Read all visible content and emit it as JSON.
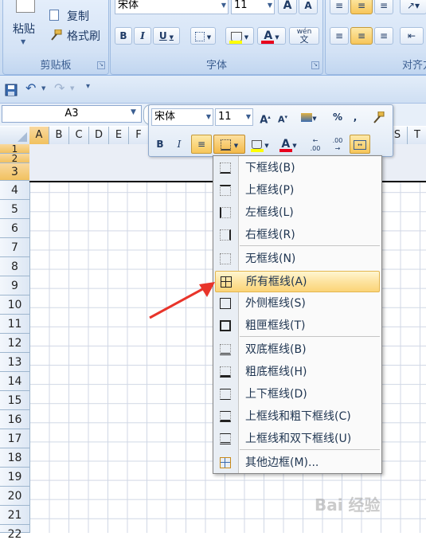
{
  "ribbon": {
    "paste_label": "粘贴",
    "copy_label": "复制",
    "format_painter_label": "格式刷",
    "clipboard_group": "剪贴板",
    "font_group": "字体",
    "align_group": "对齐方",
    "font_name": "宋体",
    "font_size": "11",
    "grow_font": "A",
    "shrink_font": "A",
    "bold": "B",
    "italic": "I",
    "underline": "U",
    "font_color_letter": "A",
    "phonetic": "wén",
    "phonetic_char": "文"
  },
  "name_box": "A3",
  "columns": [
    "A",
    "B",
    "C",
    "D",
    "E",
    "F",
    "S",
    "T"
  ],
  "rows": [
    "1",
    "2",
    "3",
    "4",
    "5",
    "6",
    "7",
    "8",
    "9",
    "10",
    "11",
    "12",
    "13",
    "14",
    "15",
    "16",
    "17",
    "18",
    "19",
    "20",
    "21",
    "22"
  ],
  "mini_toolbar": {
    "font_name": "宋体",
    "font_size": "11",
    "percent": "%",
    "comma": ",",
    "bold": "B",
    "italic": "I",
    "font_color_letter": "A",
    "inc_decimal": ".00",
    "dec_decimal": ".00"
  },
  "border_menu": {
    "items": [
      {
        "label": "下框线(B)",
        "icon": "bottom-border-icon"
      },
      {
        "label": "上框线(P)",
        "icon": "top-border-icon"
      },
      {
        "label": "左框线(L)",
        "icon": "left-border-icon"
      },
      {
        "label": "右框线(R)",
        "icon": "right-border-icon"
      },
      {
        "label": "无框线(N)",
        "icon": "no-border-icon"
      },
      {
        "label": "所有框线(A)",
        "icon": "all-borders-icon"
      },
      {
        "label": "外侧框线(S)",
        "icon": "outside-borders-icon"
      },
      {
        "label": "粗匣框线(T)",
        "icon": "thick-box-border-icon"
      },
      {
        "label": "双底框线(B)",
        "icon": "double-bottom-border-icon"
      },
      {
        "label": "粗底框线(H)",
        "icon": "thick-bottom-border-icon"
      },
      {
        "label": "上下框线(D)",
        "icon": "top-bottom-border-icon"
      },
      {
        "label": "上框线和粗下框线(C)",
        "icon": "top-thick-bottom-border-icon"
      },
      {
        "label": "上框线和双下框线(U)",
        "icon": "top-double-bottom-border-icon"
      },
      {
        "label": "其他边框(M)...",
        "icon": "more-borders-icon"
      }
    ],
    "highlighted_index": 5
  },
  "watermark": "Bai 经验",
  "colors": {
    "accent_red": "#e8342a",
    "highlight": "#fbd477",
    "fill_yellow": "#ffff00"
  }
}
